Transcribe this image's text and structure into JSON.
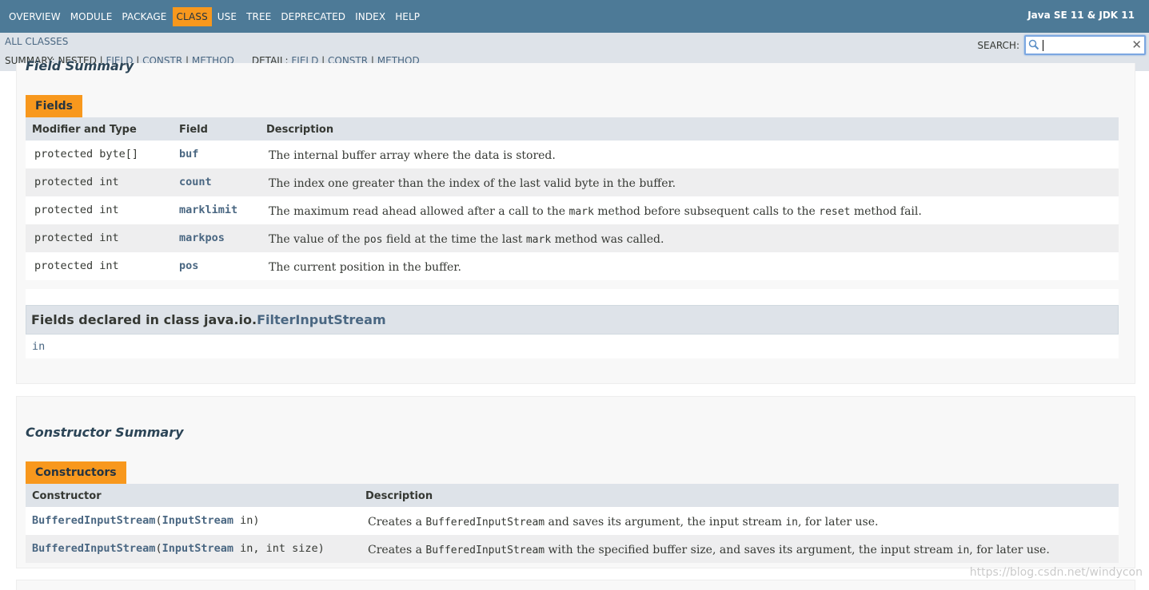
{
  "nav": {
    "items": [
      "OVERVIEW",
      "MODULE",
      "PACKAGE",
      "CLASS",
      "USE",
      "TREE",
      "DEPRECATED",
      "INDEX",
      "HELP"
    ],
    "active": "CLASS",
    "about": "Java SE 11 & JDK 11"
  },
  "subnav": {
    "all_classes": "ALL CLASSES",
    "summary_label": "SUMMARY: NESTED | ",
    "summary_field": "FIELD",
    "sep": " | ",
    "summary_constr": "CONSTR",
    "summary_method": "METHOD",
    "detail_label": "DETAIL: ",
    "detail_field": "FIELD",
    "detail_constr": "CONSTR",
    "detail_method": "METHOD",
    "search_label": "SEARCH:",
    "search_value": ""
  },
  "field_summary": {
    "title": "Field Summary",
    "caption": "Fields",
    "headers": {
      "modifier": "Modifier and Type",
      "field": "Field",
      "description": "Description"
    },
    "rows": [
      {
        "type": "protected byte[]",
        "name": "buf",
        "desc_parts": [
          {
            "t": "The internal buffer array where the data is stored."
          }
        ]
      },
      {
        "type": "protected int",
        "name": "count",
        "desc_parts": [
          {
            "t": "The index one greater than the index of the last valid byte in the buffer."
          }
        ]
      },
      {
        "type": "protected int",
        "name": "marklimit",
        "desc_parts": [
          {
            "t": "The maximum read ahead allowed after a call to the "
          },
          {
            "c": "mark"
          },
          {
            "t": " method before subsequent calls to the "
          },
          {
            "c": "reset"
          },
          {
            "t": " method fail."
          }
        ]
      },
      {
        "type": "protected int",
        "name": "markpos",
        "desc_parts": [
          {
            "t": "The value of the "
          },
          {
            "c": "pos"
          },
          {
            "t": " field at the time the last "
          },
          {
            "c": "mark"
          },
          {
            "t": " method was called."
          }
        ]
      },
      {
        "type": "protected int",
        "name": "pos",
        "desc_parts": [
          {
            "t": "The current position in the buffer."
          }
        ]
      }
    ],
    "inherited": {
      "prefix": "Fields declared in class java.io.",
      "class_link": "FilterInputStream",
      "members": "in"
    }
  },
  "constructor_summary": {
    "title": "Constructor Summary",
    "caption": "Constructors",
    "headers": {
      "constructor": "Constructor",
      "description": "Description"
    },
    "rows": [
      {
        "name": "BufferedInputStream",
        "open": "(",
        "param_type": "InputStream",
        "rest": " in)",
        "desc_parts": [
          {
            "t": "Creates a "
          },
          {
            "c": "BufferedInputStream"
          },
          {
            "t": " and saves its argument, the input stream "
          },
          {
            "c": "in"
          },
          {
            "t": ", for later use."
          }
        ]
      },
      {
        "name": "BufferedInputStream",
        "open": "(",
        "param_type": "InputStream",
        "rest": " in, int size)",
        "desc_parts": [
          {
            "t": "Creates a "
          },
          {
            "c": "BufferedInputStream"
          },
          {
            "t": " with the specified buffer size, and saves its argument, the input stream "
          },
          {
            "c": "in"
          },
          {
            "t": ", for later use."
          }
        ]
      }
    ]
  },
  "watermark": "https://blog.csdn.net/windycon"
}
